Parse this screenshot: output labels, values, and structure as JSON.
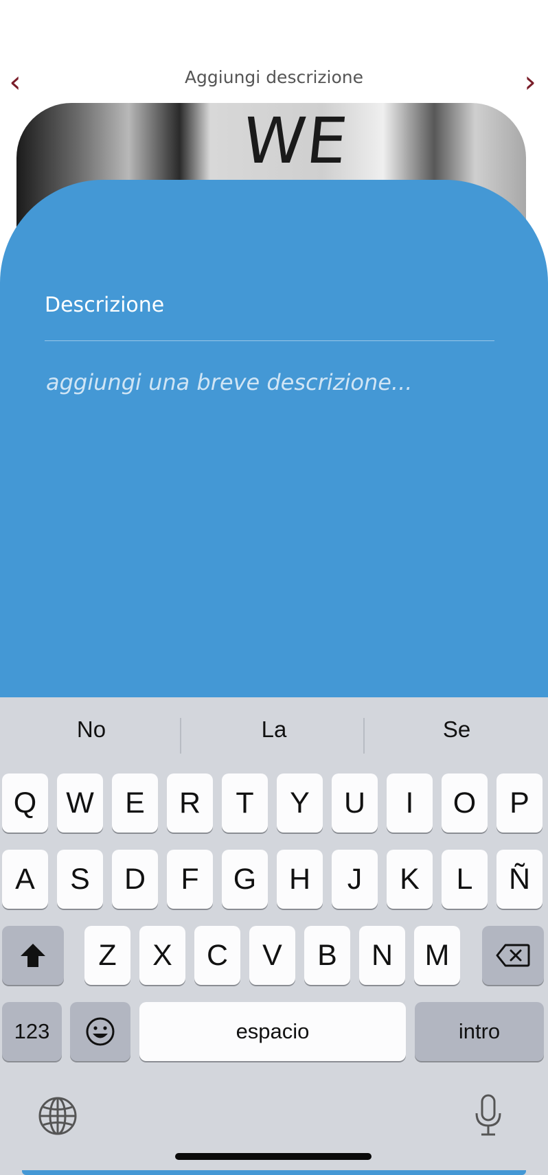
{
  "header": {
    "title": "Aggiungi descrizione",
    "prev_icon": "‹",
    "next_icon": "›"
  },
  "photo": {
    "visible_text": "WE"
  },
  "form": {
    "label": "Descrizione",
    "placeholder": "aggiungi una breve descrizione...",
    "value": ""
  },
  "keyboard": {
    "suggestions": [
      "No",
      "La",
      "Se"
    ],
    "row1": [
      "Q",
      "W",
      "E",
      "R",
      "T",
      "Y",
      "U",
      "I",
      "O",
      "P"
    ],
    "row2": [
      "A",
      "S",
      "D",
      "F",
      "G",
      "H",
      "J",
      "K",
      "L",
      "Ñ"
    ],
    "row3": [
      "Z",
      "X",
      "C",
      "V",
      "B",
      "N",
      "M"
    ],
    "numbers_label": "123",
    "space_label": "espacio",
    "return_label": "intro"
  },
  "colors": {
    "panel": "#4498d5",
    "accent": "#7a1e2a",
    "keyboard_bg": "#d3d6dc"
  }
}
